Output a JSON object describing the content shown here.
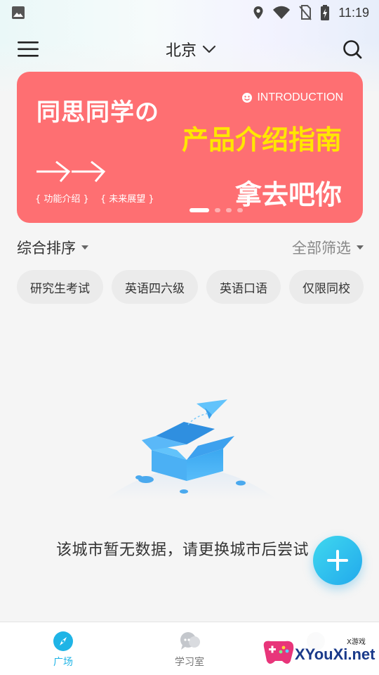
{
  "status_bar": {
    "time": "11:19",
    "icons": [
      "image-icon",
      "location-icon",
      "wifi-icon",
      "no-sim-icon",
      "battery-charging-icon"
    ]
  },
  "header": {
    "menu_icon": "menu-icon",
    "city": "北京",
    "search_icon": "search-icon"
  },
  "banner": {
    "title": "同思同学の",
    "intro_label": "INTRODUCTION",
    "highlight": "产品介绍指南",
    "tags": [
      "{ 功能介绍 }",
      "{ 未来展望 }"
    ],
    "bottom_text": "拿去吧你",
    "page_count": 4,
    "active_page": 1,
    "background_color": "#fe6f72",
    "highlight_color": "#ffe600"
  },
  "sort_bar": {
    "sort_label": "综合排序",
    "filter_label": "全部筛选"
  },
  "chips": [
    "研究生考试",
    "英语四六级",
    "英语口语",
    "仅限同校"
  ],
  "empty_state": {
    "message": "该城市暂无数据，请更换城市后尝试"
  },
  "fab": {
    "icon": "plus-icon",
    "color": "#22a9ec"
  },
  "bottom_nav": {
    "items": [
      {
        "label": "广场",
        "icon": "compass-icon",
        "active": true
      },
      {
        "label": "学习室",
        "icon": "chat-bubbles-icon",
        "active": false
      },
      {
        "label": "",
        "icon": "profile-icon",
        "active": false
      }
    ],
    "active_color": "#1fb4e6"
  },
  "watermark": {
    "text": "XYouXi.net",
    "small_text": "X游戏"
  }
}
